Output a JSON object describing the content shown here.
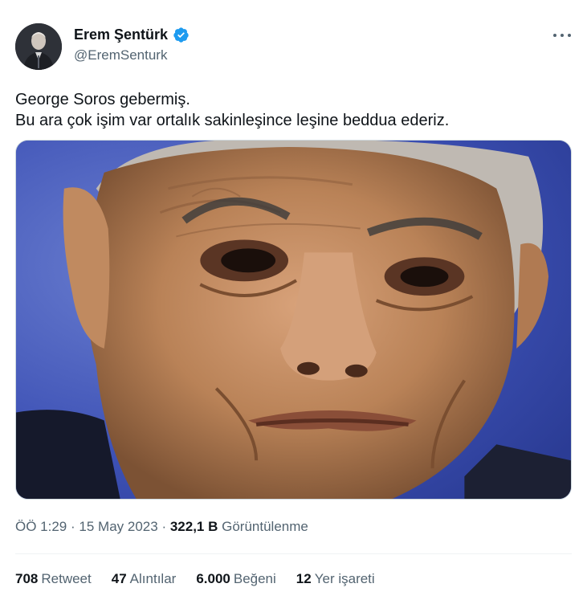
{
  "author": {
    "display_name": "Erem Şentürk",
    "handle": "@EremSenturk",
    "verified_icon": "verified-badge-icon",
    "verified_color": "#1d9bf0"
  },
  "tweet": {
    "lines": [
      "George Soros gebermiş.",
      "Bu ara çok işim var ortalık sakinleşince leşine beddua ederiz."
    ]
  },
  "meta": {
    "time": "ÖÖ 1:29",
    "date": "15 May 2023",
    "separator": "·",
    "views_count": "322,1 B",
    "views_label": "Görüntülenme"
  },
  "stats": [
    {
      "count": "708",
      "label": "Retweet"
    },
    {
      "count": "47",
      "label": "Alıntılar"
    },
    {
      "count": "6.000",
      "label": "Beğeni"
    },
    {
      "count": "12",
      "label": "Yer işareti"
    }
  ],
  "colors": {
    "text_primary": "#0f1419",
    "text_secondary": "#536471",
    "border": "#cfd9de"
  }
}
